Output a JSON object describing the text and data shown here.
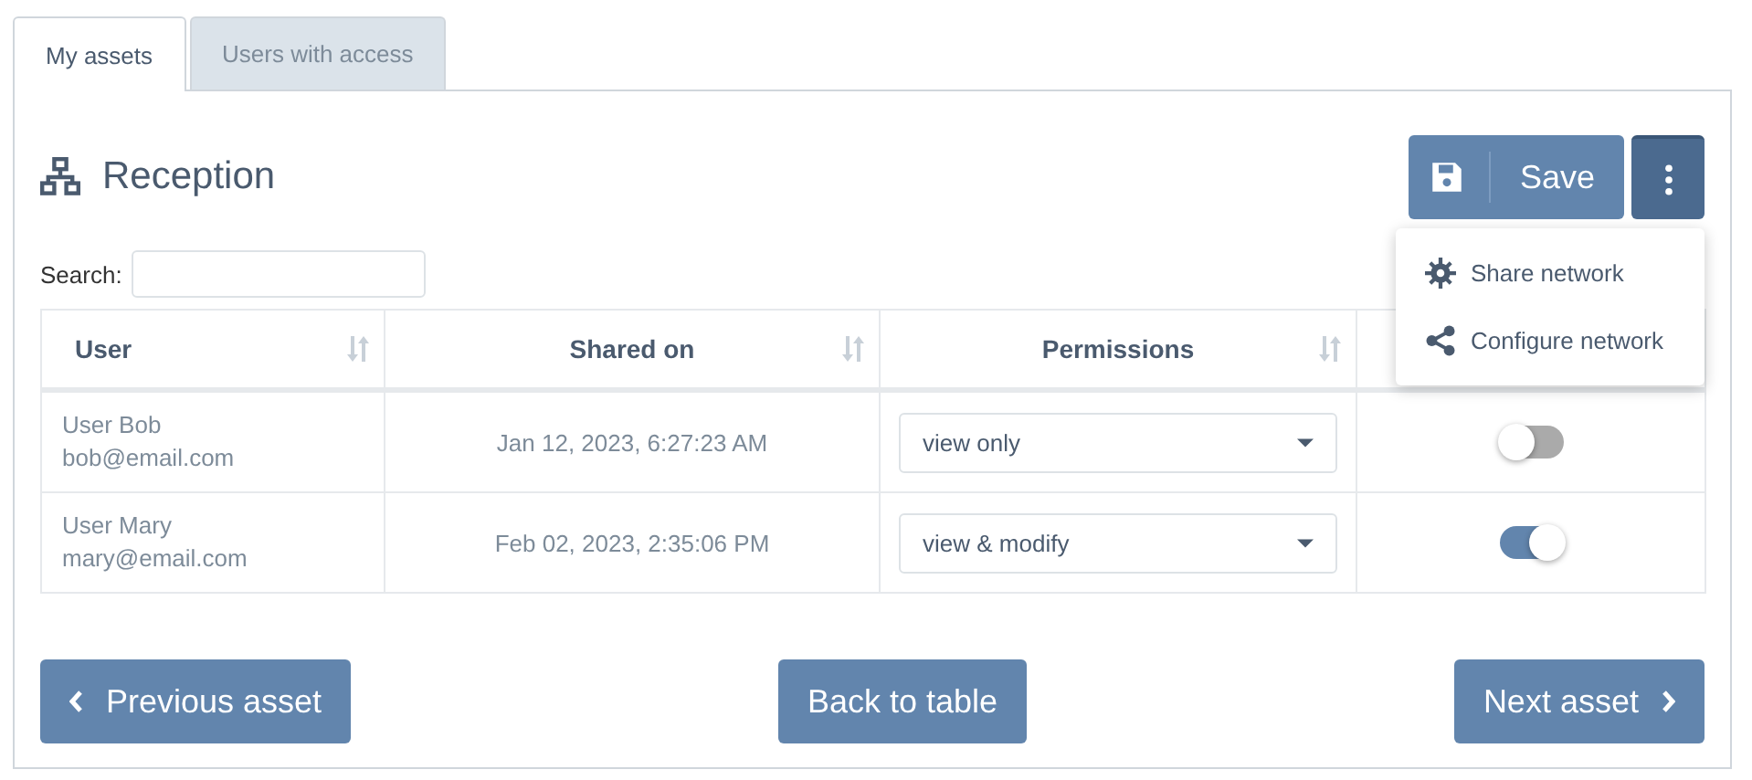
{
  "tabs": [
    {
      "label": "My assets",
      "selected": true
    },
    {
      "label": "Users with access",
      "selected": false
    }
  ],
  "title": "Reception",
  "save_button": "Save",
  "menu": {
    "expanded": true,
    "items": [
      {
        "label": "Share network",
        "kind": "gear"
      },
      {
        "label": "Configure network",
        "kind": "share"
      }
    ]
  },
  "search": {
    "label": "Search:"
  },
  "table": {
    "columns": [
      "User",
      "Shared on",
      "Permissions"
    ],
    "rows": [
      {
        "name": "User Bob",
        "email": "bob@email.com",
        "shared_on": "Jan 12, 2023, 6:27:23 AM",
        "permission": "view only",
        "on": false
      },
      {
        "name": "User Mary",
        "email": "mary@email.com",
        "shared_on": "Feb 02, 2023, 2:35:06 PM",
        "permission": "view & modify",
        "on": true
      }
    ]
  },
  "buttons": {
    "previous": "Previous asset",
    "back": "Back to table",
    "next": "Next asset"
  }
}
